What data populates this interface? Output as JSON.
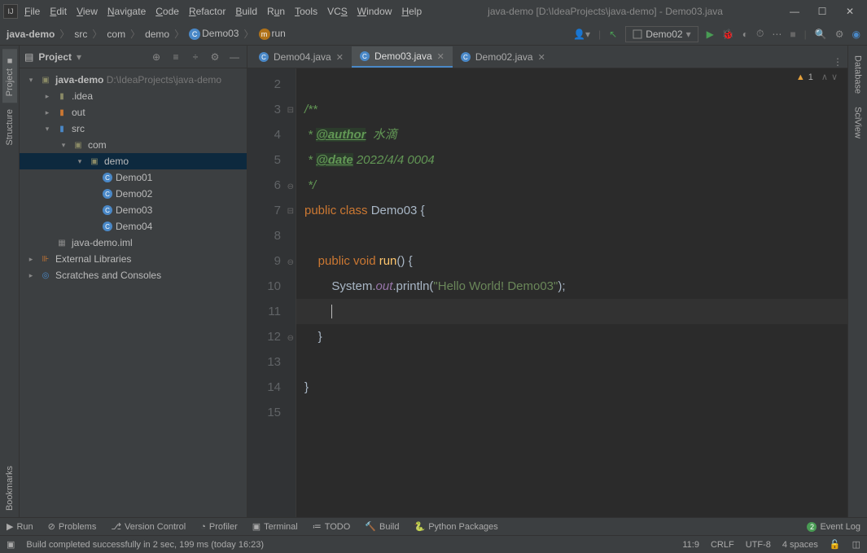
{
  "menu": {
    "file": "File",
    "edit": "Edit",
    "view": "View",
    "navigate": "Navigate",
    "code": "Code",
    "refactor": "Refactor",
    "build": "Build",
    "run": "Run",
    "tools": "Tools",
    "vcs": "VCS",
    "window": "Window",
    "help": "Help"
  },
  "title": "java-demo [D:\\IdeaProjects\\java-demo] - Demo03.java",
  "breadcrumb": {
    "root": "java-demo",
    "src": "src",
    "com": "com",
    "demo": "demo",
    "cls": "Demo03",
    "method": "run"
  },
  "run_config": "Demo02",
  "panel": {
    "title": "Project"
  },
  "tree": {
    "root": "java-demo",
    "root_path": "D:\\IdeaProjects\\java-demo",
    "idea": ".idea",
    "out": "out",
    "src": "src",
    "com": "com",
    "demo": "demo",
    "d1": "Demo01",
    "d2": "Demo02",
    "d3": "Demo03",
    "d4": "Demo04",
    "iml": "java-demo.iml",
    "ext": "External Libraries",
    "scratch": "Scratches and Consoles"
  },
  "tabs": {
    "t1": "Demo04.java",
    "t2": "Demo03.java",
    "t3": "Demo02.java"
  },
  "warn_count": "1",
  "code": {
    "l3": "/**",
    "l4_pre": " * ",
    "l4_tag": "@author",
    "l4_post": "  水滴",
    "l5_pre": " * ",
    "l5_tag": "@date",
    "l5_post": " 2022/4/4 0004",
    "l6": " */",
    "l7_kw": "public class ",
    "l7_cls": "Demo03 {",
    "l9_pre": "    ",
    "l9_kw": "public void ",
    "l9_fn": "run",
    "l9_post": "() {",
    "l10_pre": "        System.",
    "l10_out": "out",
    "l10_mid": ".println(",
    "l10_str": "\"Hello World! Demo03\"",
    "l10_end": ");",
    "l12": "    }",
    "l14": "}"
  },
  "gutter": [
    "2",
    "3",
    "4",
    "5",
    "6",
    "7",
    "8",
    "9",
    "10",
    "11",
    "12",
    "13",
    "14",
    "15"
  ],
  "bottom": {
    "run": "Run",
    "problems": "Problems",
    "vc": "Version Control",
    "profiler": "Profiler",
    "terminal": "Terminal",
    "todo": "TODO",
    "build": "Build",
    "python": "Python Packages",
    "eventlog": "Event Log",
    "event_count": "2"
  },
  "status": {
    "msg": "Build completed successfully in 2 sec, 199 ms (today 16:23)",
    "pos": "11:9",
    "eol": "CRLF",
    "enc": "UTF-8",
    "indent": "4 spaces"
  },
  "right_tabs": {
    "db": "Database",
    "sci": "SciView"
  },
  "left_tabs": {
    "project": "Project",
    "structure": "Structure",
    "bookmarks": "Bookmarks"
  }
}
